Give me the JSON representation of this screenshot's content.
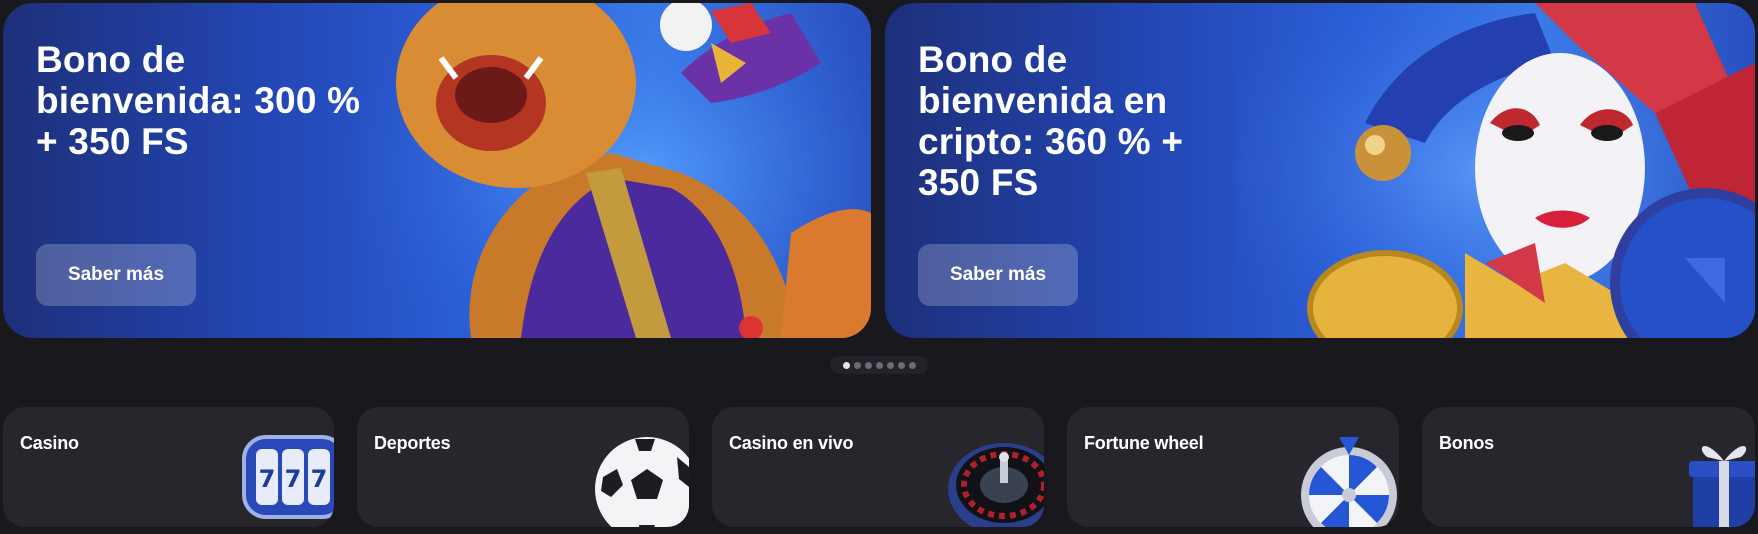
{
  "banners": [
    {
      "title": "Bono de bienvenida: 300 % + 350 FS",
      "button_label": "Saber más",
      "art": "lion-character"
    },
    {
      "title": "Bono de bienvenida en cripto: 360 % + 350 FS",
      "button_label": "Saber más",
      "art": "jester-mask"
    }
  ],
  "pagination": {
    "total": 7,
    "active": 0
  },
  "categories": [
    {
      "label": "Casino",
      "icon": "slot-reels-icon"
    },
    {
      "label": "Deportes",
      "icon": "soccer-ball-icon"
    },
    {
      "label": "Casino en vivo",
      "icon": "roulette-icon"
    },
    {
      "label": "Fortune wheel",
      "icon": "fortune-wheel-icon"
    },
    {
      "label": "Bonos",
      "icon": "gift-box-icon"
    }
  ],
  "colors": {
    "background": "#18181d",
    "card": "#26262c",
    "banner_blue": "#2b5fd8",
    "accent_blue": "#2456d6"
  }
}
